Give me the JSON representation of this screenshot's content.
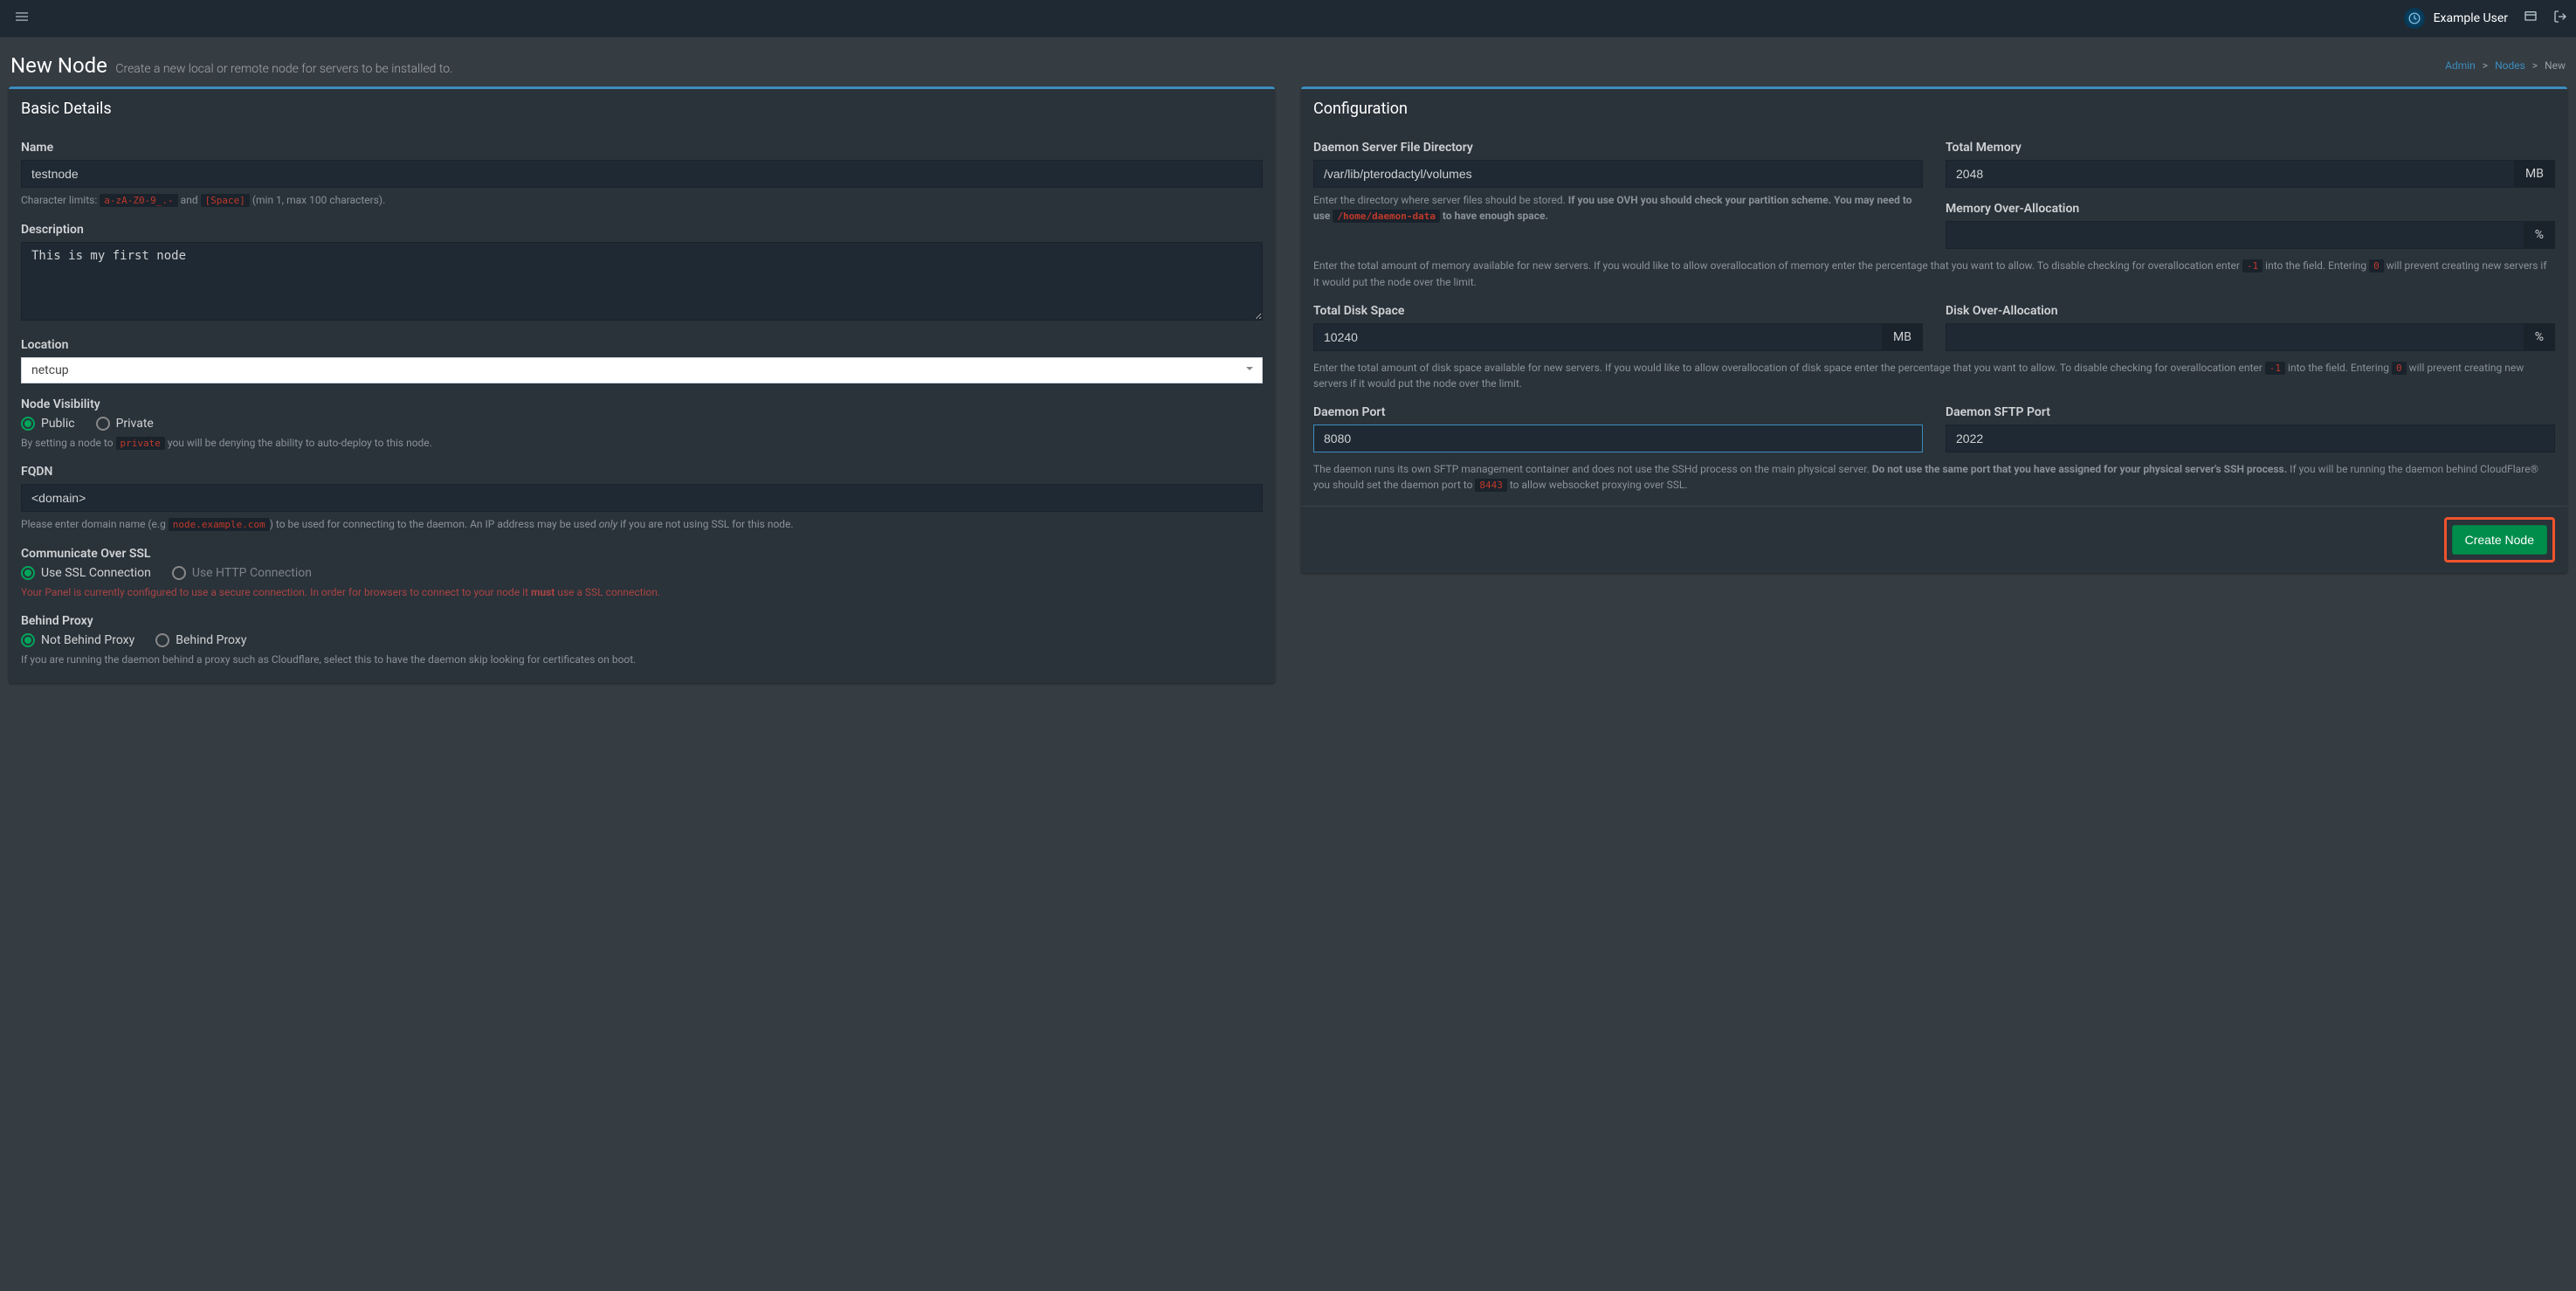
{
  "topbar": {
    "username": "Example User"
  },
  "header": {
    "title": "New Node",
    "subtitle": "Create a new local or remote node for servers to be installed to."
  },
  "breadcrumb": {
    "admin": "Admin",
    "nodes": "Nodes",
    "current": "New"
  },
  "basic": {
    "panel_title": "Basic Details",
    "name": {
      "label": "Name",
      "value": "testnode",
      "help_pre": "Character limits: ",
      "code1": "a-zA-Z0-9_.-",
      "mid": " and ",
      "code2": "[Space]",
      "post": " (min 1, max 100 characters)."
    },
    "description": {
      "label": "Description",
      "value": "This is my first node"
    },
    "location": {
      "label": "Location",
      "value": "netcup"
    },
    "visibility": {
      "label": "Node Visibility",
      "public": "Public",
      "private": "Private",
      "help_pre": "By setting a node to ",
      "code": "private",
      "help_post": " you will be denying the ability to auto-deploy to this node."
    },
    "fqdn": {
      "label": "FQDN",
      "value": "<domain>",
      "help_pre": "Please enter domain name (e.g ",
      "code": "node.example.com",
      "help_mid": ") to be used for connecting to the daemon. An IP address may be used ",
      "only": "only",
      "help_post": " if you are not using SSL for this node."
    },
    "ssl": {
      "label": "Communicate Over SSL",
      "opt1": "Use SSL Connection",
      "opt2": "Use HTTP Connection",
      "warn_pre": "Your Panel is currently configured to use a secure connection. In order for browsers to connect to your node it ",
      "must": "must",
      "warn_post": " use a SSL connection."
    },
    "proxy": {
      "label": "Behind Proxy",
      "opt1": "Not Behind Proxy",
      "opt2": "Behind Proxy",
      "help": "If you are running the daemon behind a proxy such as Cloudflare, select this to have the daemon skip looking for certificates on boot."
    }
  },
  "config": {
    "panel_title": "Configuration",
    "dir": {
      "label": "Daemon Server File Directory",
      "value": "/var/lib/pterodactyl/volumes",
      "help_pre": "Enter the directory where server files should be stored. ",
      "help_bold": "If you use OVH you should check your partition scheme. You may need to use ",
      "code": "/home/daemon-data",
      "help_post": " to have enough space."
    },
    "memory": {
      "label": "Total Memory",
      "value": "2048",
      "unit": "MB"
    },
    "mem_over": {
      "label": "Memory Over-Allocation",
      "unit": "%"
    },
    "mem_help": {
      "pre": "Enter the total amount of memory available for new servers. If you would like to allow overallocation of memory enter the percentage that you want to allow. To disable checking for overallocation enter ",
      "code1": "-1",
      "mid": " into the field. Entering ",
      "code2": "0",
      "post": " will prevent creating new servers if it would put the node over the limit."
    },
    "disk": {
      "label": "Total Disk Space",
      "value": "10240",
      "unit": "MB"
    },
    "disk_over": {
      "label": "Disk Over-Allocation",
      "unit": "%"
    },
    "disk_help": {
      "pre": "Enter the total amount of disk space available for new servers. If you would like to allow overallocation of disk space enter the percentage that you want to allow. To disable checking for overallocation enter ",
      "code1": "-1",
      "mid": " into the field. Entering ",
      "code2": "0",
      "post": " will prevent creating new servers if it would put the node over the limit."
    },
    "port": {
      "label": "Daemon Port",
      "value": "8080"
    },
    "sftp": {
      "label": "Daemon SFTP Port",
      "value": "2022"
    },
    "port_help": {
      "pre": "The daemon runs its own SFTP management container and does not use the SSHd process on the main physical server. ",
      "bold": "Do not use the same port that you have assigned for your physical server's SSH process.",
      "mid": " If you will be running the daemon behind CloudFlare® you should set the daemon port to ",
      "code": "8443",
      "post": " to allow websocket proxying over SSL."
    },
    "create": "Create Node"
  }
}
